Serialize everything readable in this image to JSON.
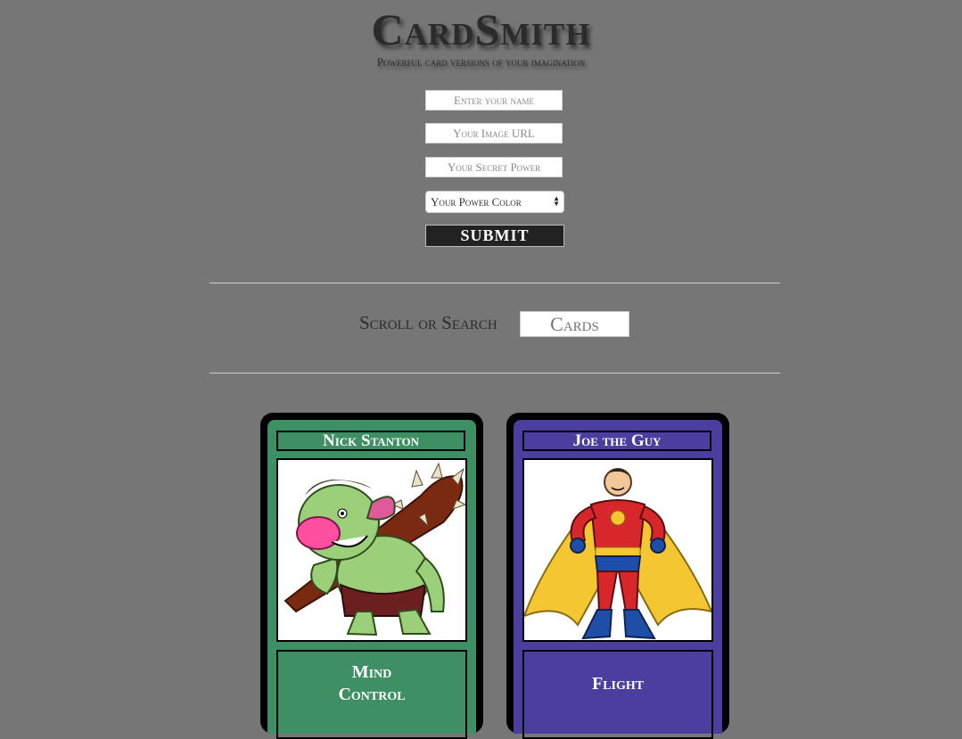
{
  "header": {
    "title": "CardSmith",
    "subtitle": "Powerful card versions of your imagination"
  },
  "form": {
    "name_placeholder": "Enter your name",
    "image_placeholder": "Your Image URL",
    "power_placeholder": "Your Secret Power",
    "color_select_value": "Your Power Color",
    "submit_label": "SUBMIT"
  },
  "search": {
    "label": "Scroll or Search",
    "placeholder": "Cards"
  },
  "cards": [
    {
      "name": "Nick Stanton",
      "image_icon": "troll-with-club",
      "power": "Mind Control",
      "color": "#3e8f63"
    },
    {
      "name": "Joe the Guy",
      "image_icon": "superhero-with-cape",
      "power": "Flight",
      "color": "#4a3f9e"
    }
  ]
}
